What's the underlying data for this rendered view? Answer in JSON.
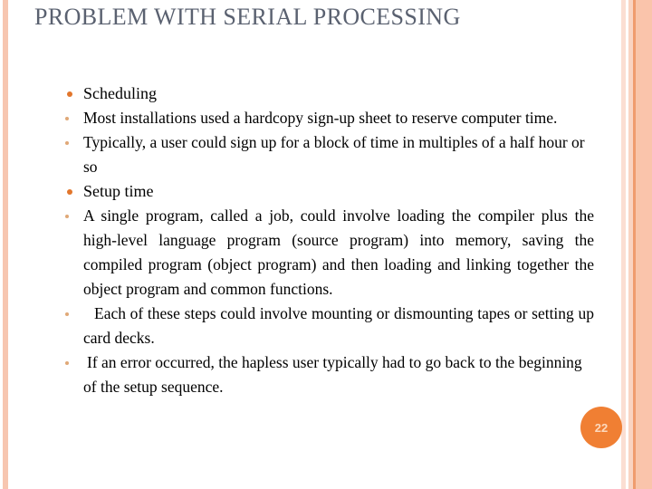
{
  "slide": {
    "title": "Problem with Serial Processing",
    "title_color": "#5a6170",
    "background_color": "#ffffff",
    "page_number": "22",
    "page_badge_color": "#f07f33",
    "page_badge_text_color": "#fcd9bd",
    "accent_colors": {
      "bullet_level1": "#e2762c",
      "bullet_level2": "#e0a877",
      "edge_bar_light": "#f7c6b0",
      "edge_bar_pale": "#fbded2",
      "edge_bar_dark": "#ef9c6e"
    },
    "bullets": [
      {
        "level": 1,
        "text": "Scheduling"
      },
      {
        "level": 2,
        "text": "Most installations used a hardcopy sign-up sheet to reserve computer time."
      },
      {
        "level": 2,
        "text": " Typically, a user could sign up for a block of time in multiples of a half hour or so"
      },
      {
        "level": 1,
        "text": "Setup time"
      },
      {
        "level": 2,
        "text": "A single program, called a job, could involve loading the compiler plus the high-level language program (source program) into memory, saving the compiled program (object program) and then loading and linking together the object program and common functions."
      },
      {
        "level": 2,
        "text": "Each of these steps could involve mounting or dismounting tapes or setting up card decks."
      },
      {
        "level": 2,
        "text": " If an error occurred, the hapless user typically had to go back to the beginning of the setup sequence."
      }
    ]
  }
}
